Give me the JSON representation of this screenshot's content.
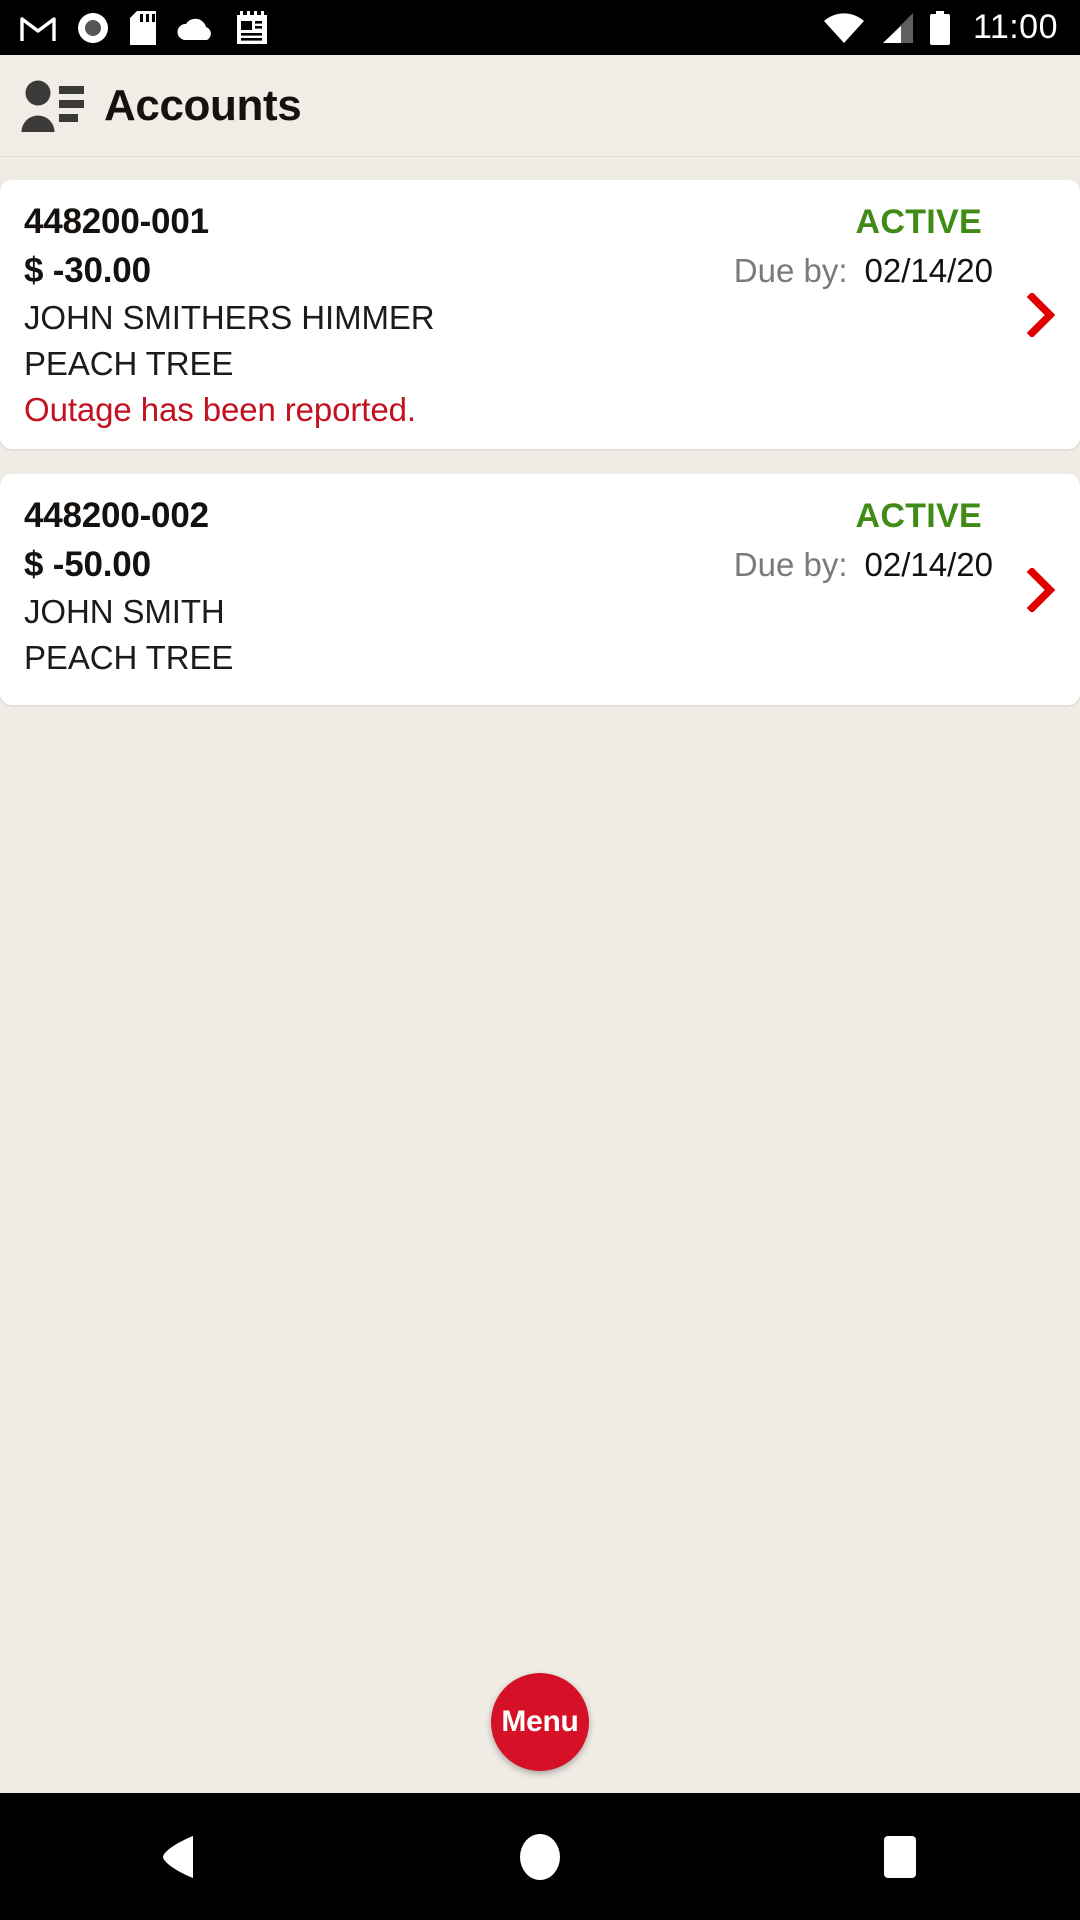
{
  "status_bar": {
    "time": "11:00",
    "left_icons": [
      "gmail-icon",
      "screen-record-icon",
      "sd-card-icon",
      "cloud-icon",
      "notes-icon"
    ],
    "right_icons": [
      "wifi-icon",
      "cellular-signal-icon",
      "battery-icon"
    ],
    "background_color": "#000000",
    "foreground_color": "#ffffff"
  },
  "app_bar": {
    "title": "Accounts",
    "icon": "accounts-contact-icon",
    "background_color": "#f1ece6"
  },
  "colors": {
    "page_background": "#efebe5",
    "card_background": "#ffffff",
    "status_active": "#3f8b16",
    "alert_red": "#c41120",
    "accent_red": "#d61127",
    "muted_text": "#7a7a7a"
  },
  "accounts": [
    {
      "account_number": "448200-001",
      "status": "ACTIVE",
      "amount": "$ -30.00",
      "due_label": "Due by:",
      "due_date": "02/14/20",
      "customer_name": "JOHN SMITHERS HIMMER",
      "service_location": "PEACH TREE",
      "alert": "Outage has been reported.",
      "chevron": "chevron-right-icon"
    },
    {
      "account_number": "448200-002",
      "status": "ACTIVE",
      "amount": "$ -50.00",
      "due_label": "Due by:",
      "due_date": "02/14/20",
      "customer_name": "JOHN SMITH",
      "service_location": "PEACH TREE",
      "alert": "",
      "chevron": "chevron-right-icon"
    }
  ],
  "fab": {
    "label": "Menu",
    "color": "#d61127"
  },
  "navigation_bar": {
    "back": "back-triangle-icon",
    "home": "home-circle-icon",
    "recents": "recents-square-icon",
    "background_color": "#000000"
  }
}
